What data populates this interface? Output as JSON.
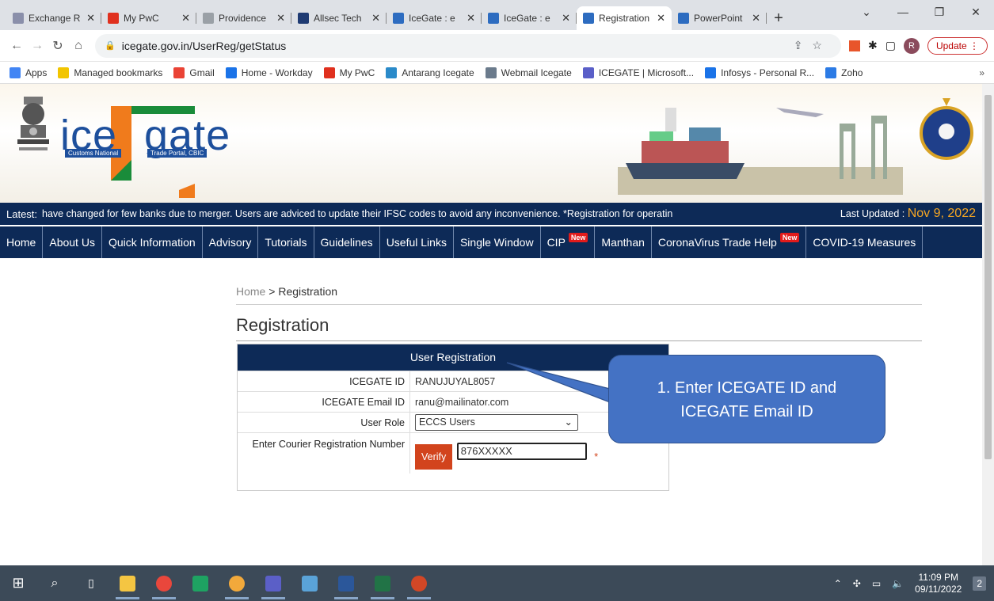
{
  "browser": {
    "tabs": [
      {
        "title": "Exchange R",
        "fav_color": "#8a8faa"
      },
      {
        "title": "My PwC",
        "fav_color": "#e0301e"
      },
      {
        "title": "Providence",
        "fav_color": "#9aa0a6"
      },
      {
        "title": "Allsec Tech",
        "fav_color": "#1f3b73"
      },
      {
        "title": "IceGate : e",
        "fav_color": "#2d6cc0"
      },
      {
        "title": "IceGate : e",
        "fav_color": "#2d6cc0"
      },
      {
        "title": "Registration",
        "fav_color": "#2d6cc0",
        "active": true
      },
      {
        "title": "PowerPoint",
        "fav_color": "#2d6cc0"
      }
    ],
    "new_tab": "+",
    "url": "icegate.gov.in/UserReg/getStatus",
    "profile_initial": "R",
    "update_label": "Update"
  },
  "bookmarks": [
    {
      "label": "Apps",
      "color": "#4285f4"
    },
    {
      "label": "Managed bookmarks",
      "color": "#f2c500"
    },
    {
      "label": "Gmail",
      "color": "#ea4335"
    },
    {
      "label": "Home - Workday",
      "color": "#1a73e8"
    },
    {
      "label": "My PwC",
      "color": "#e0301e"
    },
    {
      "label": "Antarang Icegate",
      "color": "#2a8ac9"
    },
    {
      "label": "Webmail Icegate",
      "color": "#6b7b8c"
    },
    {
      "label": "ICEGATE | Microsoft...",
      "color": "#5a5fc8"
    },
    {
      "label": "Infosys - Personal R...",
      "color": "#1a73e8"
    },
    {
      "label": "Zoho",
      "color": "#2c7be5"
    }
  ],
  "bookmarks_more": "»",
  "site": {
    "logo_ice": "ice",
    "logo_gate": "gate",
    "logo_sub_left": "Customs National",
    "logo_sub_right": "Trade Portal, CBIC",
    "ticker_label": "Latest:",
    "ticker_msg": "have changed for few banks due to merger. Users are adviced to update their IFSC codes to avoid any inconvenience. *Registration for operatin",
    "last_updated_label": "Last Updated :",
    "last_updated_date": "Nov 9, 2022",
    "nav": [
      {
        "label": "Home"
      },
      {
        "label": "About Us"
      },
      {
        "label": "Quick Information"
      },
      {
        "label": "Advisory"
      },
      {
        "label": "Tutorials"
      },
      {
        "label": "Guidelines"
      },
      {
        "label": "Useful Links"
      },
      {
        "label": "Single Window"
      },
      {
        "label": "CIP",
        "badge": "New"
      },
      {
        "label": "Manthan"
      },
      {
        "label": "CoronaVirus Trade Help",
        "badge": "New"
      },
      {
        "label": "COVID-19 Measures"
      }
    ]
  },
  "breadcrumb": {
    "home": "Home",
    "sep": ">",
    "current": "Registration"
  },
  "page_title": "Registration",
  "form": {
    "header": "User Registration",
    "icegate_id_label": "ICEGATE ID",
    "icegate_id_value": "RANUJUYAL8057",
    "email_label": "ICEGATE Email ID",
    "email_value": "ranu@mailinator.com",
    "role_label": "User Role",
    "role_value": "ECCS Users",
    "crn_label": "Enter Courier Registration Number",
    "verify_label": "Verify",
    "crn_value": "876XXXXX",
    "required_mark": "*"
  },
  "callout": {
    "line1": "1. Enter ICEGATE ID and",
    "line2": "ICEGATE Email ID"
  },
  "taskbar": {
    "time": "11:09 PM",
    "date": "09/11/2022",
    "notifications": "2"
  }
}
